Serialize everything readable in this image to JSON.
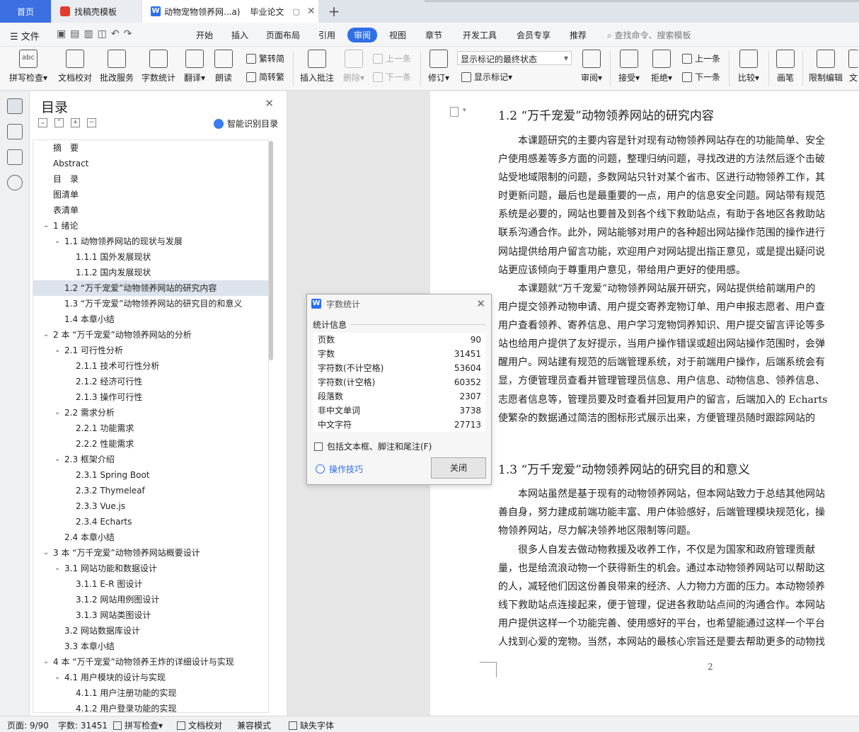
{
  "tabs": {
    "home": "首页",
    "template": "找稿壳模板",
    "document": "动物宠物领养网...a)",
    "document_extra": "毕业论文",
    "add": "+"
  },
  "menu": {
    "file": "文件",
    "items": [
      "开始",
      "插入",
      "页面布局",
      "引用",
      "审阅",
      "视图",
      "章节",
      "开发工具",
      "会员专享",
      "推荐"
    ],
    "active": "审阅",
    "search": "查找命令、搜索模板"
  },
  "ribbon": {
    "spell_check": "拼写检查",
    "doc_check": "文档校对",
    "batch_service": "批改服务",
    "word_count": "字数统计",
    "translate": "翻译",
    "read_aloud": "朗读",
    "trad_to_simp": "繁转简",
    "simp_to_trad": "简转繁",
    "insert_comment": "插入批注",
    "delete": "删除",
    "prev_comment": "上一条",
    "next_comment": "下一条",
    "revise": "修订",
    "markup_select": "显示标记的最终状态",
    "show_markup": "显示标记",
    "review": "审阅",
    "accept": "接受",
    "reject": "拒绝",
    "prev": "上一条",
    "next": "下一条",
    "compare": "比较",
    "pen": "画笔",
    "restrict_edit": "限制编辑",
    "more": "文"
  },
  "toc": {
    "title": "目录",
    "smart": "智能识别目录",
    "items": [
      {
        "label": "摘　要",
        "level": 0,
        "chev": false
      },
      {
        "label": "Abstract",
        "level": 0,
        "chev": false
      },
      {
        "label": "目　录",
        "level": 0,
        "chev": false
      },
      {
        "label": "图清单",
        "level": 0,
        "chev": false
      },
      {
        "label": "表清单",
        "level": 0,
        "chev": false
      },
      {
        "label": "1  绪论",
        "level": 0,
        "chev": true
      },
      {
        "label": "1.1  动物领养网站的现状与发展",
        "level": 1,
        "chev": true
      },
      {
        "label": "1.1.1  国外发展现状",
        "level": 2,
        "chev": false
      },
      {
        "label": "1.1.2  国内发展现状",
        "level": 2,
        "chev": false
      },
      {
        "label": "1.2  “万千宠爱”动物领养网站的研究内容",
        "level": 1,
        "chev": false,
        "selected": true
      },
      {
        "label": "1.3  “万千宠爱”动物领养网站的研究目的和意义",
        "level": 1,
        "chev": false
      },
      {
        "label": "1.4  本章小结",
        "level": 1,
        "chev": false
      },
      {
        "label": "2  本 “万千宠爱”动物领养网站的分析",
        "level": 0,
        "chev": true
      },
      {
        "label": "2.1  可行性分析",
        "level": 1,
        "chev": true
      },
      {
        "label": "2.1.1  技术可行性分析",
        "level": 2,
        "chev": false
      },
      {
        "label": "2.1.2  经济可行性",
        "level": 2,
        "chev": false
      },
      {
        "label": "2.1.3  操作可行性",
        "level": 2,
        "chev": false
      },
      {
        "label": "2.2  需求分析",
        "level": 1,
        "chev": true
      },
      {
        "label": "2.2.1  功能需求",
        "level": 2,
        "chev": false
      },
      {
        "label": "2.2.2  性能需求",
        "level": 2,
        "chev": false
      },
      {
        "label": "2.3  框架介绍",
        "level": 1,
        "chev": true
      },
      {
        "label": "2.3.1 Spring Boot",
        "level": 2,
        "chev": false
      },
      {
        "label": "2.3.2 Thymeleaf",
        "level": 2,
        "chev": false
      },
      {
        "label": "2.3.3 Vue.js",
        "level": 2,
        "chev": false
      },
      {
        "label": "2.3.4 Echarts",
        "level": 2,
        "chev": false
      },
      {
        "label": "2.4  本章小结",
        "level": 1,
        "chev": false
      },
      {
        "label": "3  本 “万千宠爱”动物领养网站概要设计",
        "level": 0,
        "chev": true
      },
      {
        "label": "3.1  网站功能和数据设计",
        "level": 1,
        "chev": true
      },
      {
        "label": "3.1.1 E-R 图设计",
        "level": 2,
        "chev": false
      },
      {
        "label": "3.1.2  网站用例图设计",
        "level": 2,
        "chev": false
      },
      {
        "label": "3.1.3  网站类图设计",
        "level": 2,
        "chev": false
      },
      {
        "label": "3.2  网站数据库设计",
        "level": 1,
        "chev": false
      },
      {
        "label": "3.3  本章小结",
        "level": 1,
        "chev": false
      },
      {
        "label": "4  本 “万千宠爱”动物领养王炸的详细设计与实现",
        "level": 0,
        "chev": true
      },
      {
        "label": "4.1  用户模块的设计与实现",
        "level": 1,
        "chev": true
      },
      {
        "label": "4.1.1  用户注册功能的实现",
        "level": 2,
        "chev": false
      },
      {
        "label": "4.1.2  用户登录功能的实现",
        "level": 2,
        "chev": false
      }
    ]
  },
  "document": {
    "heading1": "1.2  “万千宠爱”动物领养网站的研究内容",
    "para1": [
      "　　本课题研究的主要内容是针对现有动物领养网站存在的功能简单、安全",
      "户使用感差等多方面的问题，整理归纳问题，寻找改进的方法然后逐个击破",
      "站受地域限制的问题，多数网站只针对某个省市、区进行动物领养工作，其",
      "时更新问题，最后也是最重要的一点，用户的信息安全问题。网站带有规范",
      "系统是必要的，网站也要普及到各个线下救助站点，有助于各地区各救助站",
      "联系沟通合作。此外，网站能够对用户的各种超出网站操作范围的操作进行",
      "网站提供给用户留言功能，欢迎用户对网站提出指正意见，或是提出疑问说",
      "站更应该倾向于尊重用户意见，带给用户更好的使用感。"
    ],
    "para2": [
      "　　本课题就“万千宠爱”动物领养网站展开研究，网站提供给前端用户的",
      "用户提交领养动物申请、用户提交寄养宠物订单、用户申报志愿者、用户查",
      "用户查看领养、寄养信息、用户学习宠物饲养知识、用户提交留言评论等多",
      "站也给用户提供了友好提示，当用户操作错误或超出网站操作范围时，会弹",
      "醒用户。网站建有规范的后端管理系统，对于前端用户操作，后端系统会有",
      "显，方便管理员查看并管理管理员信息、用户信息、动物信息、领养信息、",
      "志愿者信息等，管理员要及时查看并回复用户的留言，后端加入的 Echarts",
      "使繁杂的数据通过简洁的图标形式展示出来，方便管理员随时跟踪网站的"
    ],
    "heading2": "1.3  “万千宠爱”动物领养网站的研究目的和意义",
    "para3": [
      "　　本网站虽然是基于现有的动物领养网站，但本网站致力于总结其他网站",
      "善自身，努力建成前端功能丰富、用户体验感好，后端管理模块规范化，操",
      "物领养网站，尽力解决领养地区限制等问题。"
    ],
    "para4": [
      "　　很多人自发去做动物救援及收养工作，不仅是为国家和政府管理贡献",
      "量，也是给流浪动物一个获得新生的机会。通过本动物领养网站可以帮助这",
      "的人，减轻他们因这份善良带来的经济、人力物力方面的压力。本动物领养",
      "线下救助站点连接起来，便于管理，促进各救助站点间的沟通合作。本网站",
      "用户提供这样一个功能完善、使用感好的平台，也希望能通过这样一个平台",
      "人找到心爱的宠物。当然，本网站的最核心宗旨还是要去帮助更多的动物找"
    ],
    "page_number": "2"
  },
  "dialog": {
    "title": "字数统计",
    "section": "统计信息",
    "rows": [
      {
        "label": "页数",
        "value": "90"
      },
      {
        "label": "字数",
        "value": "31451"
      },
      {
        "label": "字符数(不计空格)",
        "value": "53604"
      },
      {
        "label": "字符数(计空格)",
        "value": "60352"
      },
      {
        "label": "段落数",
        "value": "2307"
      },
      {
        "label": "非中文单词",
        "value": "3738"
      },
      {
        "label": "中文字符",
        "value": "27713"
      }
    ],
    "include_label": "包括文本框、脚注和尾注(F)",
    "tips": "操作技巧",
    "close": "关闭"
  },
  "status": {
    "page": "页面: 9/90",
    "words": "字数: 31451",
    "spell": "拼写检查",
    "doc_check": "文档校对",
    "compat": "兼容模式",
    "missing_font": "缺失字体"
  }
}
